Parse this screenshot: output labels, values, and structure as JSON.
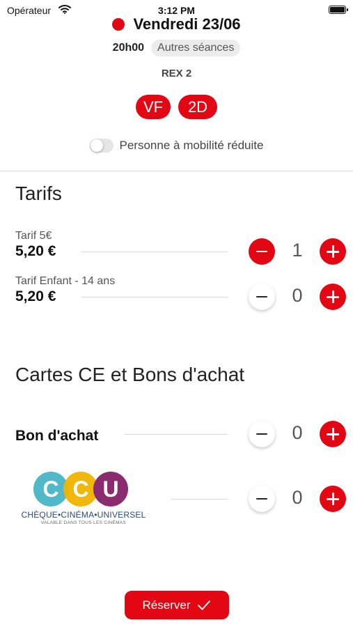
{
  "status_bar": {
    "carrier": "Opérateur",
    "time": "3:12 PM"
  },
  "session": {
    "date": "Vendredi 23/06",
    "time": "20h00",
    "other_sessions": "Autres séances",
    "room": "REX 2",
    "badges": [
      "VF",
      "2D"
    ],
    "reduced_mobility_label": "Personne à mobilité réduite",
    "reduced_mobility_enabled": false
  },
  "tarifs": {
    "title": "Tarifs",
    "items": [
      {
        "label": "Tarif 5€",
        "price": "5,20 €",
        "quantity": "1"
      },
      {
        "label": "Tarif Enfant - 14 ans",
        "price": "5,20 €",
        "quantity": "0"
      }
    ]
  },
  "cartes": {
    "title": "Cartes CE et Bons d'achat",
    "items": [
      {
        "label": "Bon d'achat",
        "quantity": "0"
      },
      {
        "logo_letters": [
          "C",
          "C",
          "U"
        ],
        "logo_name": "CHÈQUE•CINÉMA•UNIVERSEL",
        "logo_sub": "VALABLE DANS TOUS LES CINÉMAS",
        "quantity": "0"
      }
    ]
  },
  "reserve_label": "Réserver",
  "colors": {
    "accent": "#e30613",
    "ccu_cyan": "#4fb8c9",
    "ccu_yellow": "#f0b400",
    "ccu_purple": "#8a2c6e"
  },
  "icons": [
    "wifi-icon",
    "battery-icon",
    "minus-icon",
    "plus-icon",
    "check-icon"
  ]
}
